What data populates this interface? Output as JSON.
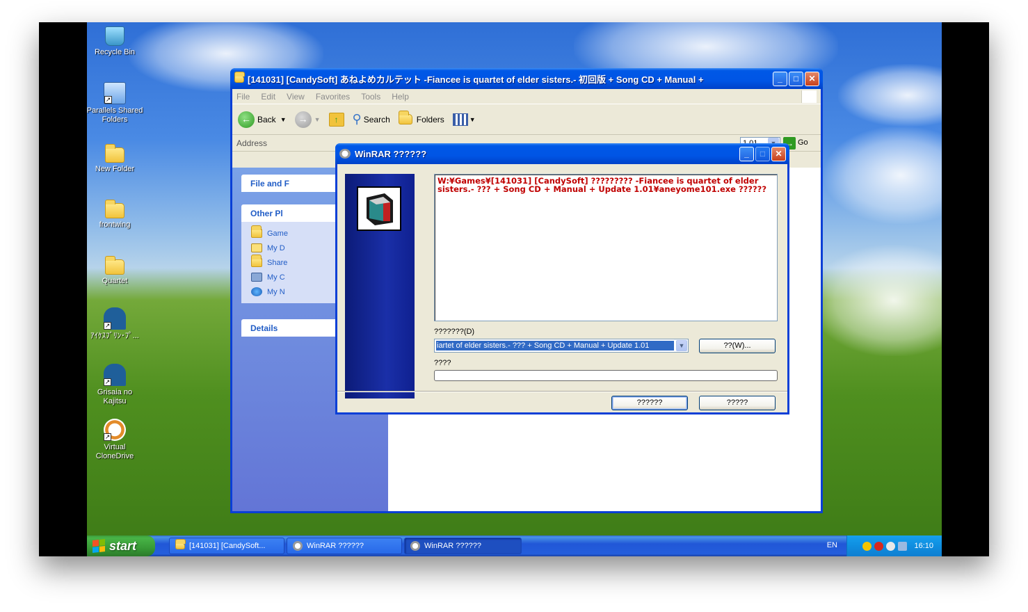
{
  "desktop": {
    "icons": [
      {
        "label": "Recycle Bin"
      },
      {
        "label": "Parallels Shared Folders"
      },
      {
        "label": "New Folder"
      },
      {
        "label": "frontwing"
      },
      {
        "label": "Quartet"
      },
      {
        "label": "ｱｲｹｽﾌﾞﾘﾝ･ﾌﾟ..."
      },
      {
        "label": "Grisaia no Kajitsu"
      },
      {
        "label": "Virtual CloneDrive"
      }
    ]
  },
  "explorer": {
    "title": "[141031] [CandySoft] あねよめカルテット -Fiancee is quartet of elder sisters.- 初回版 + Song CD + Manual +",
    "menu": [
      "File",
      "Edit",
      "View",
      "Favorites",
      "Tools",
      "Help"
    ],
    "toolbar": {
      "back": "Back",
      "search": "Search",
      "folders": "Folders"
    },
    "address_label": "Address",
    "address_value": "1.01",
    "go_label": "Go",
    "taskpane": {
      "file_tasks": "File and F",
      "other_places": "Other Pl",
      "places": [
        "Game",
        "My D",
        "Share",
        "My C",
        "My N"
      ],
      "details": "Details"
    }
  },
  "winrar": {
    "title": "WinRAR ??????",
    "path_text": "W:¥Games¥[141031] [CandySoft] ????????? -Fiancee is quartet of elder sisters.- ??? + Song CD + Manual + Update 1.01¥aneyome101.exe ??????",
    "dest_label": "???????(D)",
    "dest_value": "iartet of elder sisters.- ??? + Song CD + Manual + Update 1.01",
    "browse_button": "??(W)...",
    "progress_label": "????",
    "progress": 0,
    "install_button": "??????",
    "cancel_button": "?????"
  },
  "taskbar": {
    "start": "start",
    "tasks": [
      {
        "label": "[141031] [CandySoft..."
      },
      {
        "label": "WinRAR ??????"
      },
      {
        "label": "WinRAR ??????"
      }
    ],
    "lang": "EN",
    "clock": "16:10"
  }
}
